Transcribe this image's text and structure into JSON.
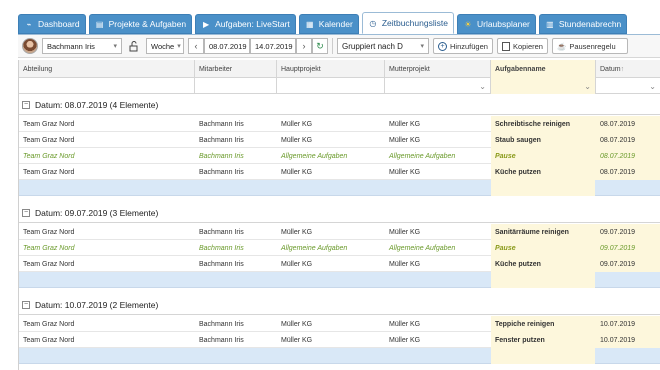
{
  "tabs": [
    {
      "label": "Dashboard",
      "icon": "dashboard-icon"
    },
    {
      "label": "Projekte & Aufgaben",
      "icon": "folder-icon"
    },
    {
      "label": "Aufgaben: LiveStart",
      "icon": "play-icon"
    },
    {
      "label": "Kalender",
      "icon": "calendar-icon"
    },
    {
      "label": "Zeitbuchungsliste",
      "icon": "clock-icon",
      "active": true
    },
    {
      "label": "Urlaubsplaner",
      "icon": "sun-icon"
    },
    {
      "label": "Stundenabrechn",
      "icon": "report-icon"
    }
  ],
  "toolbar": {
    "user": "Bachmann Iris",
    "period": "Woche",
    "date_from": "08.07.2019",
    "date_to": "14.07.2019",
    "group_by": "Gruppiert nach D",
    "add_label": "Hinzufügen",
    "copy_label": "Kopieren",
    "break_label": "Pausenregelu"
  },
  "columns": [
    "Abteilung",
    "Mitarbeiter",
    "Hauptprojekt",
    "Mutterprojekt",
    "Aufgabenname",
    "Datum"
  ],
  "groups": [
    {
      "label": "Datum: 08.07.2019 (4 Elemente)",
      "rows": [
        {
          "abteilung": "Team Graz Nord",
          "mitarbeiter": "Bachmann Iris",
          "hauptprojekt": "Müller KG",
          "mutterprojekt": "Müller KG",
          "aufgabe": "Schreibtische reinigen",
          "datum": "08.07.2019",
          "pause": false
        },
        {
          "abteilung": "Team Graz Nord",
          "mitarbeiter": "Bachmann Iris",
          "hauptprojekt": "Müller KG",
          "mutterprojekt": "Müller KG",
          "aufgabe": "Staub saugen",
          "datum": "08.07.2019",
          "pause": false
        },
        {
          "abteilung": "Team Graz Nord",
          "mitarbeiter": "Bachmann Iris",
          "hauptprojekt": "Allgemeine Aufgaben",
          "mutterprojekt": "Allgemeine Aufgaben",
          "aufgabe": "Pause",
          "datum": "08.07.2019",
          "pause": true
        },
        {
          "abteilung": "Team Graz Nord",
          "mitarbeiter": "Bachmann Iris",
          "hauptprojekt": "Müller KG",
          "mutterprojekt": "Müller KG",
          "aufgabe": "Küche putzen",
          "datum": "08.07.2019",
          "pause": false
        }
      ]
    },
    {
      "label": "Datum: 09.07.2019 (3 Elemente)",
      "rows": [
        {
          "abteilung": "Team Graz Nord",
          "mitarbeiter": "Bachmann Iris",
          "hauptprojekt": "Müller KG",
          "mutterprojekt": "Müller KG",
          "aufgabe": "Sanitärräume reinigen",
          "datum": "09.07.2019",
          "pause": false
        },
        {
          "abteilung": "Team Graz Nord",
          "mitarbeiter": "Bachmann Iris",
          "hauptprojekt": "Allgemeine Aufgaben",
          "mutterprojekt": "Allgemeine Aufgaben",
          "aufgabe": "Pause",
          "datum": "09.07.2019",
          "pause": true
        },
        {
          "abteilung": "Team Graz Nord",
          "mitarbeiter": "Bachmann Iris",
          "hauptprojekt": "Müller KG",
          "mutterprojekt": "Müller KG",
          "aufgabe": "Küche putzen",
          "datum": "09.07.2019",
          "pause": false
        }
      ]
    },
    {
      "label": "Datum: 10.07.2019 (2 Elemente)",
      "rows": [
        {
          "abteilung": "Team Graz Nord",
          "mitarbeiter": "Bachmann Iris",
          "hauptprojekt": "Müller KG",
          "mutterprojekt": "Müller KG",
          "aufgabe": "Teppiche reinigen",
          "datum": "10.07.2019",
          "pause": false
        },
        {
          "abteilung": "Team Graz Nord",
          "mitarbeiter": "Bachmann Iris",
          "hauptprojekt": "Müller KG",
          "mutterprojekt": "Müller KG",
          "aufgabe": "Fenster putzen",
          "datum": "10.07.2019",
          "pause": false
        }
      ]
    }
  ],
  "colors": {
    "tab": "#4a90c8",
    "pause_text": "#6a9a2a",
    "task_highlight": "#fdf7dc",
    "summary_row": "#d9e8f7"
  }
}
